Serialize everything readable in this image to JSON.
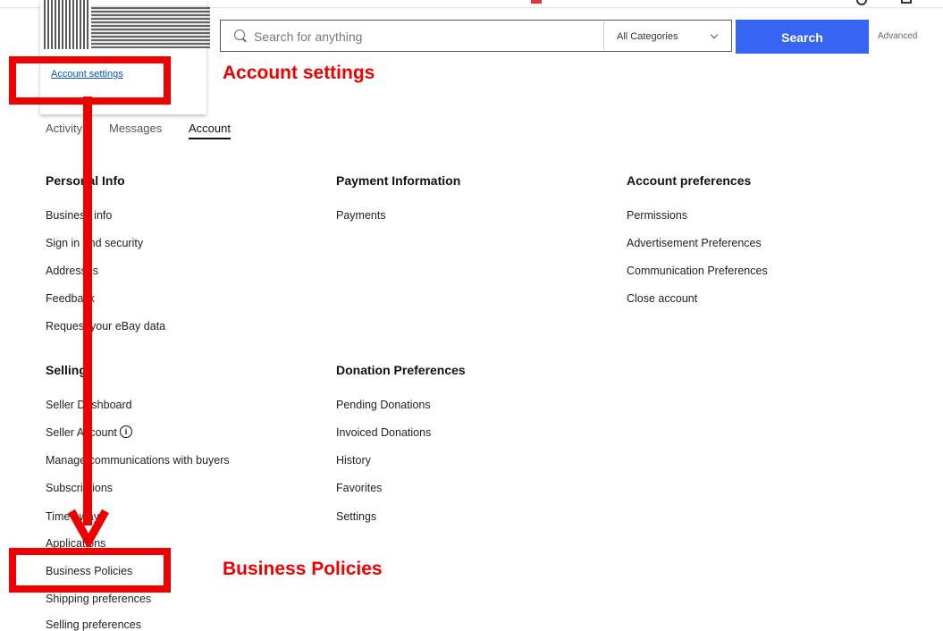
{
  "menu": {
    "account_settings": "Account settings"
  },
  "search": {
    "placeholder": "Search for anything",
    "category": "All Categories",
    "button": "Search",
    "advanced": "Advanced"
  },
  "tabs": [
    "Activity",
    "Messages",
    "Account"
  ],
  "personal_info": {
    "title": "Personal Info",
    "items": [
      "Business info",
      "Sign in and security",
      "Addresses",
      "Feedback",
      "Request your eBay data"
    ]
  },
  "payment_info": {
    "title": "Payment Information",
    "items": [
      "Payments"
    ]
  },
  "account_prefs": {
    "title": "Account preferences",
    "items": [
      "Permissions",
      "Advertisement Preferences",
      "Communication Preferences",
      "Close account"
    ]
  },
  "selling": {
    "title": "Selling",
    "items": [
      "Seller Dashboard",
      "Seller Account",
      "Manage communications with buyers",
      "Subscriptions",
      "Time away",
      "Applications",
      "Business Policies",
      "Shipping preferences",
      "Selling preferences"
    ]
  },
  "donation_prefs": {
    "title": "Donation Preferences",
    "items": [
      "Pending Donations",
      "Invoiced Donations",
      "History",
      "Favorites",
      "Settings"
    ]
  },
  "annotations": {
    "account_settings": "Account settings",
    "business_policies": "Business Policies"
  },
  "colors": {
    "accent": "#3665f3",
    "annotation": "#ee0000",
    "link": "#0654ba"
  },
  "icons": [
    "search-icon",
    "chevron-down-icon",
    "info-icon",
    "bell-icon",
    "cart-icon"
  ]
}
